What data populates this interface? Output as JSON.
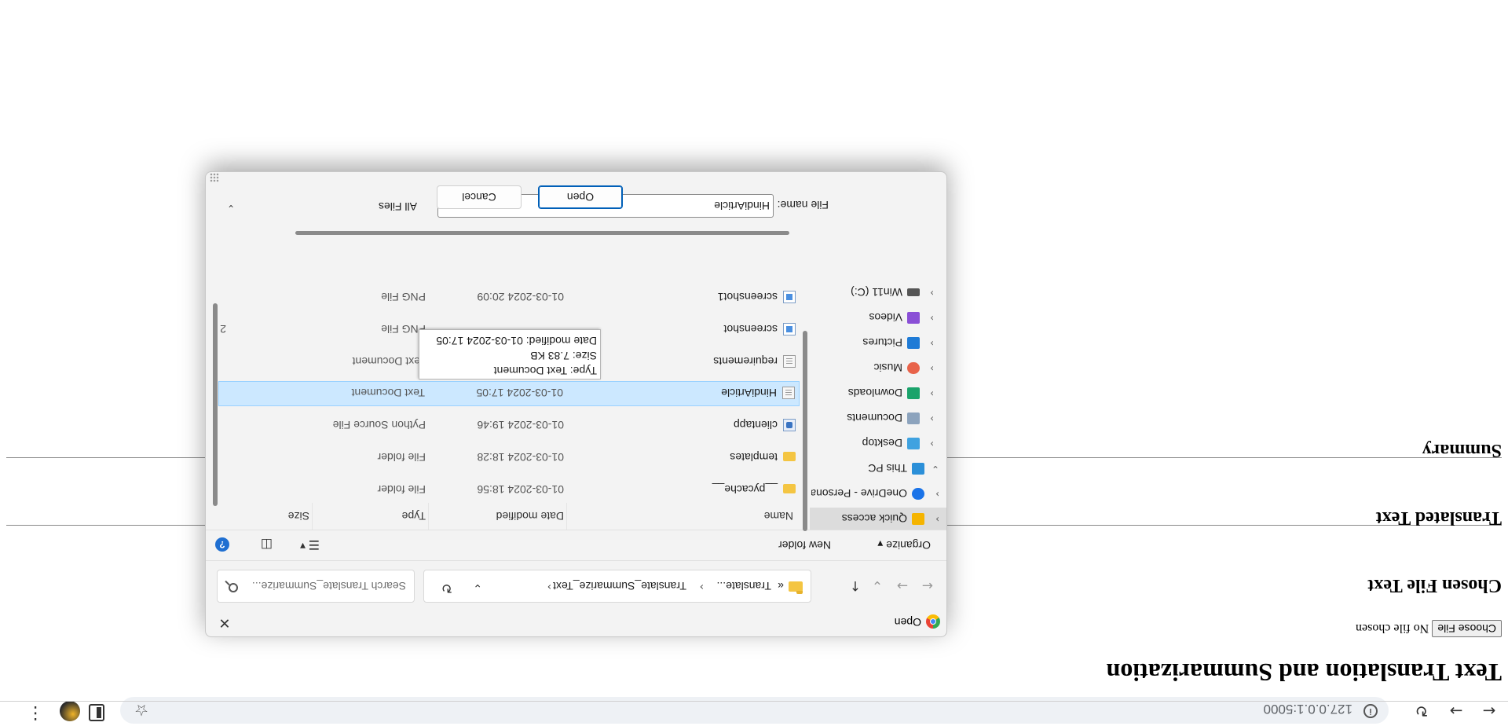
{
  "browser": {
    "url": "127.0.0.1:5000",
    "icons": {
      "back": "arrow-left-icon",
      "forward": "arrow-right-icon",
      "reload": "reload-icon",
      "info": "site-info-icon",
      "bookmark": "star-icon",
      "extension": "side-panel-icon",
      "profile": "profile-icon",
      "menu": "more-vert-icon"
    }
  },
  "page": {
    "title": "Text Translation and Summarization",
    "choose_button": "Choose File",
    "no_file": "No file chosen",
    "sections": [
      "Chosen File Text",
      "Translated Text",
      "Summary"
    ]
  },
  "dialog": {
    "title": "Open",
    "close_icon": "close-icon",
    "breadcrumb": [
      "«",
      "Translate...",
      "Translate_Summarize_Text"
    ],
    "search_placeholder": "Search Translate_Summarize...",
    "toolbar": {
      "organize": "Organize",
      "new_folder": "New folder"
    },
    "tree": [
      {
        "label": "Quick access",
        "color": "#f5b400",
        "selected": true
      },
      {
        "label": "OneDrive - Personal",
        "color": "#1a73e8"
      },
      {
        "label": "This PC",
        "color": "#2b8fd8",
        "expanded": true
      },
      {
        "label": "Desktop",
        "color": "#3fa2e0"
      },
      {
        "label": "Documents",
        "color": "#8ca3bd"
      },
      {
        "label": "Downloads",
        "color": "#1aa36b"
      },
      {
        "label": "Music",
        "color": "#e8634a"
      },
      {
        "label": "Pictures",
        "color": "#1f7bd6"
      },
      {
        "label": "Videos",
        "color": "#8a4fd6"
      },
      {
        "label": "Win11 (C:)",
        "color": "#555555"
      }
    ],
    "columns": [
      "Name",
      "Date modified",
      "Type",
      "Size"
    ],
    "files": [
      {
        "name": "__pycache__",
        "date": "01-03-2024 18:56",
        "type": "File folder",
        "size": "",
        "icon": "folder-icon"
      },
      {
        "name": "templates",
        "date": "01-03-2024 18:28",
        "type": "File folder",
        "size": "",
        "icon": "folder-icon"
      },
      {
        "name": "clientapp",
        "date": "01-03-2024 19:46",
        "type": "Python Source File",
        "size": "",
        "icon": "python-file-icon"
      },
      {
        "name": "HindiArticle",
        "date": "01-03-2024 17:05",
        "type": "Text Document",
        "size": "",
        "icon": "text-file-icon",
        "selected": true
      },
      {
        "name": "requirements",
        "date": "",
        "type": "Text Document",
        "size": "",
        "icon": "text-file-icon"
      },
      {
        "name": "screenshot",
        "date": "",
        "type": "PNG File",
        "size": "2",
        "icon": "image-file-icon"
      },
      {
        "name": "screenshot1",
        "date": "01-03-2024 20:09",
        "type": "PNG File",
        "size": "",
        "icon": "image-file-icon"
      }
    ],
    "tooltip": [
      "Type: Text Document",
      "Size: 7.83 KB",
      "Date modified: 01-03-2024 17:05"
    ],
    "file_name_label": "File name:",
    "file_name_value": "HindiArticle",
    "file_type": "All Files",
    "open_button": "Open",
    "cancel_button": "Cancel"
  }
}
